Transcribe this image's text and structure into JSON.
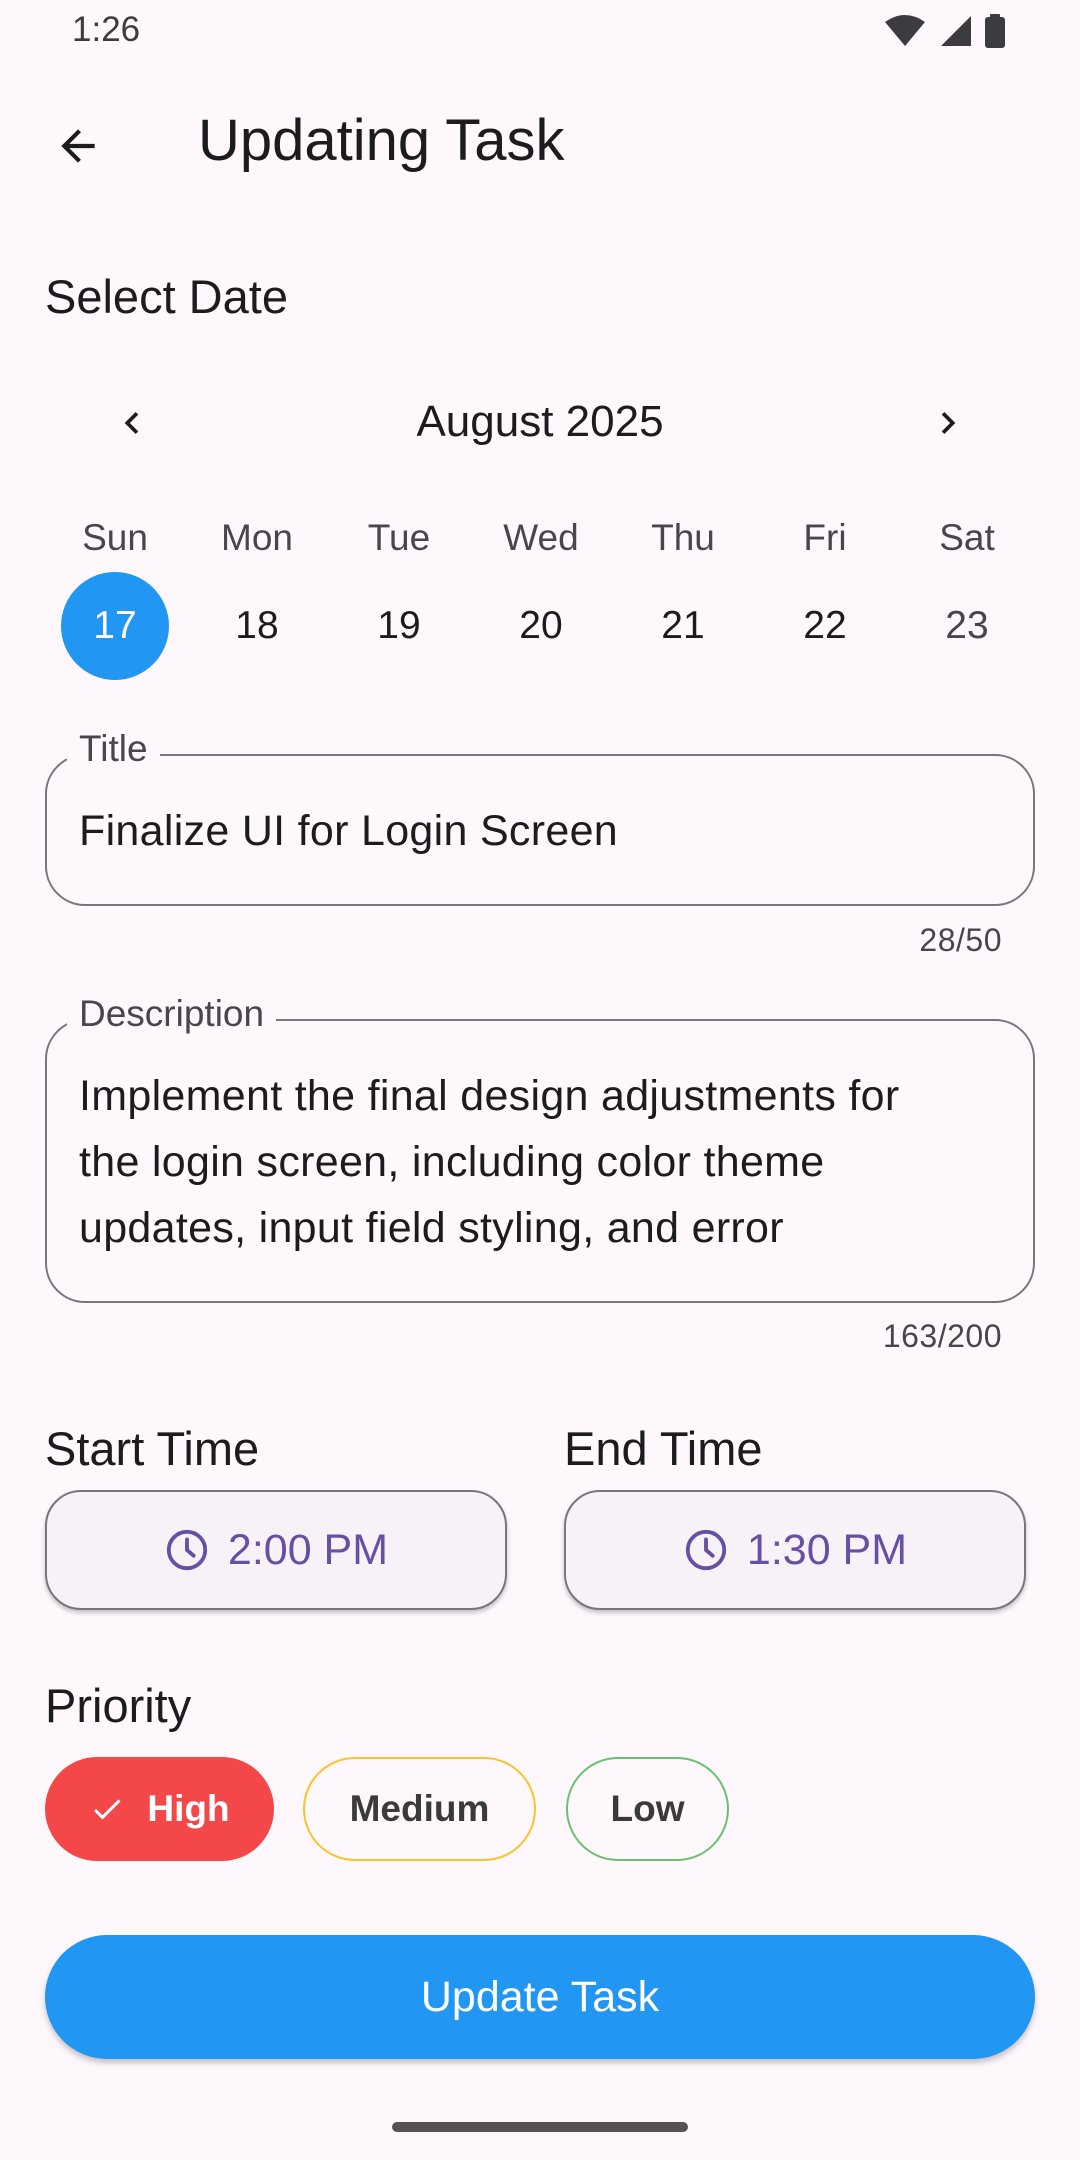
{
  "status_bar": {
    "time": "1:26"
  },
  "app_bar": {
    "title": "Updating Task",
    "back_icon": "arrow-back-icon"
  },
  "date_section": {
    "heading": "Select Date",
    "month_label": "August 2025",
    "weekdays": [
      "Sun",
      "Mon",
      "Tue",
      "Wed",
      "Thu",
      "Fri",
      "Sat"
    ],
    "days": [
      "17",
      "18",
      "19",
      "20",
      "21",
      "22",
      "23"
    ],
    "selected_day": "17",
    "selected_color": "#2196F3"
  },
  "title_field": {
    "label": "Title",
    "value": "Finalize UI for Login Screen",
    "counter": "28/50"
  },
  "description_field": {
    "label": "Description",
    "lines": [
      "Implement the final design adjustments for",
      "the login screen, including color theme",
      "updates, input field styling, and error"
    ],
    "counter": "163/200"
  },
  "time_section": {
    "start_heading": "Start Time",
    "start_value": "2:00 PM",
    "end_heading": "End Time",
    "end_value": "1:30 PM",
    "icon": "clock-icon",
    "accent": "#6750A4"
  },
  "priority_section": {
    "heading": "Priority",
    "options": [
      {
        "label": "High",
        "selected": true,
        "color": "#F44749"
      },
      {
        "label": "Medium",
        "selected": false,
        "color": "#F9C32E"
      },
      {
        "label": "Low",
        "selected": false,
        "color": "#6CC070"
      }
    ]
  },
  "primary_action": {
    "label": "Update Task",
    "color": "#2196F3"
  }
}
